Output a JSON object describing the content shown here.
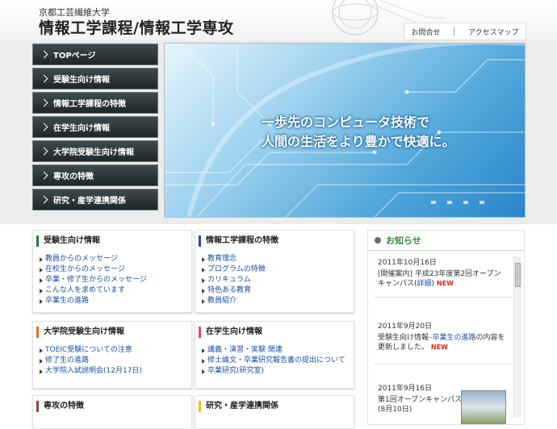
{
  "header": {
    "university": "京都工芸繊維大学",
    "title": "情報工学課程/情報工学専攻",
    "links": [
      "お問合せ",
      "アクセスマップ"
    ]
  },
  "nav": {
    "items": [
      "TOPページ",
      "受験生向け情報",
      "情報工学課程の特徴",
      "在学生向け情報",
      "大学院受験生向け情報",
      "専攻の特徴",
      "研究・産学連携関係"
    ]
  },
  "hero": {
    "line1": "一歩先のコンピュータ技術で",
    "line2": "人間の生活をより豊かで快適に。"
  },
  "boxes": [
    {
      "title": "受験生向け情報",
      "color": "#2a7a3a",
      "items": [
        "教員からのメッセージ",
        "在校生からのメッセージ",
        "卒業・修了生からのメッセージ",
        "こんな人を求めています",
        "卒業生の進路"
      ]
    },
    {
      "title": "情報工学課程の特徴",
      "color": "#1e4f8a",
      "items": [
        "教育理念",
        "プログラムの特徴",
        "カリキュラム",
        "特色ある教育",
        "教員紹介"
      ]
    },
    {
      "title": "大学院受験生向け情報",
      "color": "#e86a1a",
      "items": [
        "TOEIC受験についての注意",
        "修了生の進路",
        "大学院入試説明会(12月17日)"
      ]
    },
    {
      "title": "在学生向け情報",
      "color": "#d84a6a",
      "items": [
        "講義・演習・実験 関連",
        "修士論文・卒業研究報告書の提出について",
        "卒業研究(研究室)"
      ]
    },
    {
      "title": "専攻の特徴",
      "color": "#8a4a2a",
      "items": []
    },
    {
      "title": "研究・産学連携関係",
      "color": "#e8c41a",
      "items": []
    }
  ],
  "news": {
    "heading": "お知らせ",
    "items": [
      {
        "date": "2011年10月16日",
        "text1": "[開催案内] 平成23年度第2回オープンキャンパス(",
        "link": "詳細",
        "text2": ")",
        "new": "NEW"
      },
      {
        "date": "2011年9月20日",
        "text1": "受験生向け情報–",
        "link": "卒業生の進路",
        "text2": "の内容を更新しました。",
        "new": "NEW"
      },
      {
        "date": "2011年9月16日",
        "text1": "第1回オープンキャンパス(8月10日)",
        "link": "",
        "text2": "",
        "new": ""
      }
    ]
  }
}
